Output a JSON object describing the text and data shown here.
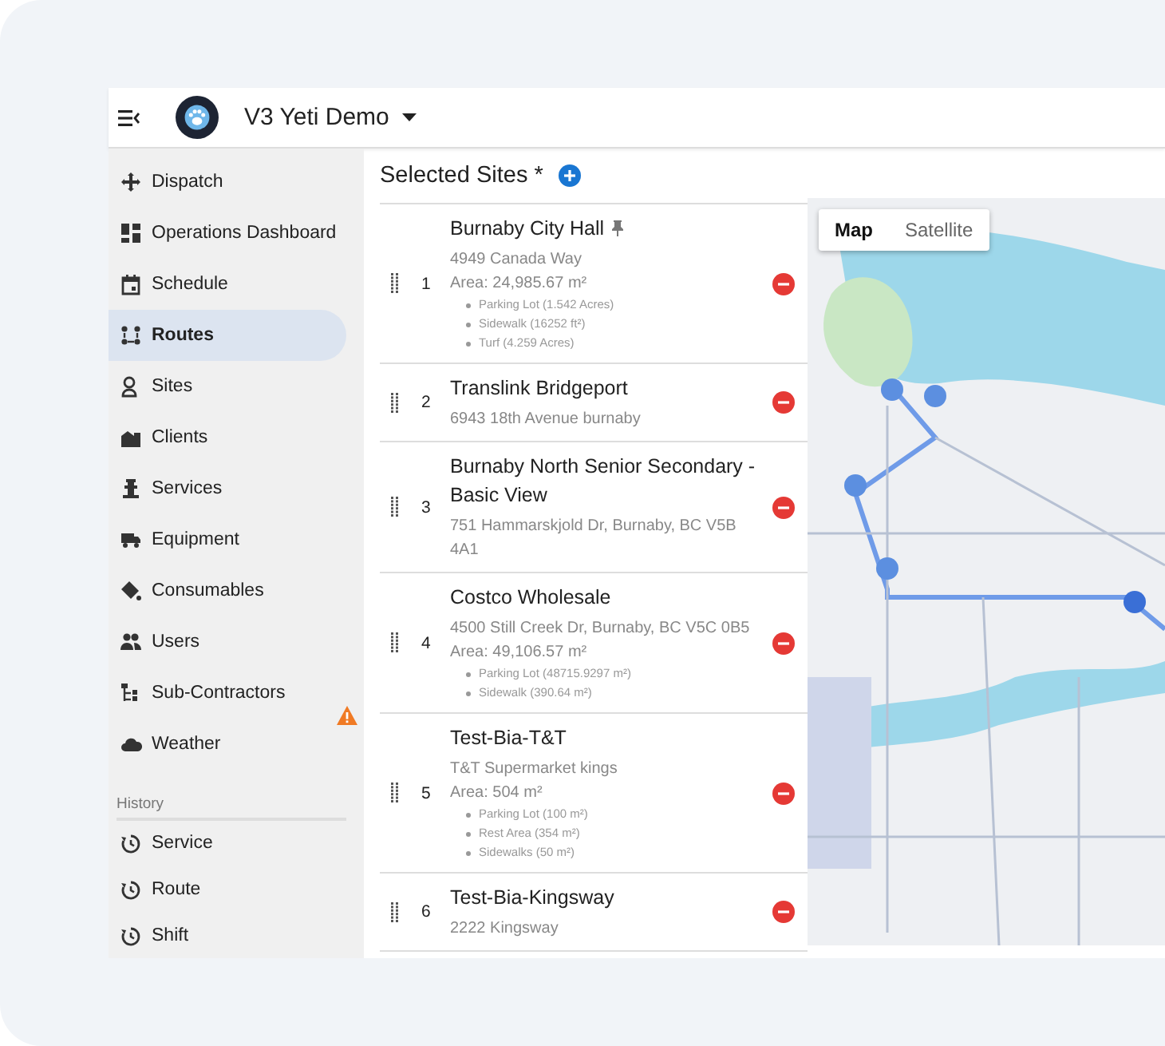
{
  "header": {
    "title": "V3 Yeti Demo"
  },
  "sidebar": {
    "items": [
      {
        "label": "Dispatch",
        "selected": false,
        "warning": false
      },
      {
        "label": "Operations Dashboard",
        "selected": false,
        "warning": false
      },
      {
        "label": "Schedule",
        "selected": false,
        "warning": false
      },
      {
        "label": "Routes",
        "selected": true,
        "warning": false
      },
      {
        "label": "Sites",
        "selected": false,
        "warning": false
      },
      {
        "label": "Clients",
        "selected": false,
        "warning": false
      },
      {
        "label": "Services",
        "selected": false,
        "warning": false
      },
      {
        "label": "Equipment",
        "selected": false,
        "warning": false
      },
      {
        "label": "Consumables",
        "selected": false,
        "warning": false
      },
      {
        "label": "Users",
        "selected": false,
        "warning": false
      },
      {
        "label": "Sub-Contractors",
        "selected": false,
        "warning": false
      },
      {
        "label": "Weather",
        "selected": false,
        "warning": true
      }
    ],
    "history": {
      "label": "History",
      "items": [
        {
          "label": "Service"
        },
        {
          "label": "Route"
        },
        {
          "label": "Shift"
        }
      ]
    }
  },
  "sites": {
    "title": "Selected Sites *",
    "items": [
      {
        "number": "1",
        "name": "Burnaby City Hall",
        "pinned": true,
        "address": "4949 Canada Way",
        "area": "Area: 24,985.67 m²",
        "areas": [
          "Parking Lot (1.542 Acres)",
          "Sidewalk (16252 ft²)",
          "Turf (4.259 Acres)"
        ]
      },
      {
        "number": "2",
        "name": "Translink Bridgeport",
        "pinned": false,
        "address": "6943 18th Avenue burnaby"
      },
      {
        "number": "3",
        "name": "Burnaby North Senior Secondary - Basic View",
        "pinned": false,
        "address": "751 Hammarskjold Dr, Burnaby, BC V5B 4A1"
      },
      {
        "number": "4",
        "name": "Costco Wholesale",
        "pinned": false,
        "address": "4500 Still Creek Dr, Burnaby, BC V5C 0B5",
        "area": "Area: 49,106.57 m²",
        "areas": [
          "Parking Lot (48715.9297 m²)",
          "Sidewalk (390.64 m²)"
        ]
      },
      {
        "number": "5",
        "name": "Test-Bia-T&T",
        "pinned": false,
        "address": "T&T Supermarket kings",
        "area": "Area: 504 m²",
        "areas": [
          "Parking Lot (100 m²)",
          "Rest Area (354 m²)",
          "Sidewalks (50 m²)"
        ]
      },
      {
        "number": "6",
        "name": "Test-Bia-Kingsway",
        "pinned": false,
        "address": "2222 Kingsway"
      }
    ]
  },
  "map": {
    "map_types": [
      {
        "label": "Map",
        "selected": true
      },
      {
        "label": "Satellite",
        "selected": false
      }
    ]
  }
}
